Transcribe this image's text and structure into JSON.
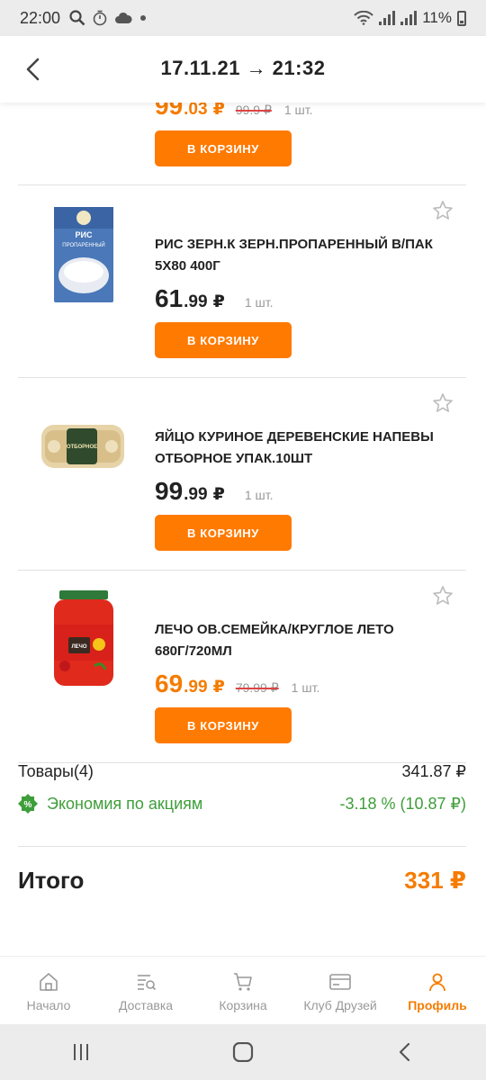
{
  "status_bar": {
    "time": "22:00",
    "battery": "11%"
  },
  "header": {
    "title": "17.11.21 → 21:32"
  },
  "items": [
    {
      "name": "",
      "price_rub": "99",
      "price_kop": ".03",
      "currency": "₽",
      "old_price": "99.9 ₽",
      "qty": "1 шт.",
      "button": "В КОРЗИНУ"
    },
    {
      "name": "РИС ЗЕРН.К ЗЕРН.ПРОПАРЕННЫЙ В/ПАК 5Х80 400Г",
      "price_rub": "61",
      "price_kop": ".99",
      "currency": "₽",
      "qty": "1 шт.",
      "button": "В КОРЗИНУ",
      "image_text": "РИС ПРОПАРЕННЫЙ"
    },
    {
      "name": "ЯЙЦО КУРИНОЕ ДЕРЕВЕНСКИЕ НАПЕВЫ ОТБОРНОЕ УПАК.10ШТ",
      "price_rub": "99",
      "price_kop": ".99",
      "currency": "₽",
      "qty": "1 шт.",
      "button": "В КОРЗИНУ",
      "image_text": "ОТБОРНОЕ"
    },
    {
      "name": "ЛЕЧО ОВ.СЕМЕЙКА/КРУГЛОЕ ЛЕТО 680Г/720МЛ",
      "price_rub": "69",
      "price_kop": ".99",
      "currency": "₽",
      "old_price": "79.99 ₽",
      "qty": "1 шт.",
      "button": "В КОРЗИНУ",
      "image_text": "ЛЕЧО"
    }
  ],
  "summary": {
    "goods_label": "Товары(4)",
    "goods_value": "341.87 ₽",
    "savings_label": "Экономия по акциям",
    "savings_value": "-3.18 % (10.87 ₽)",
    "total_label": "Итого",
    "total_value": "331 ₽"
  },
  "nav": [
    {
      "label": "Начало",
      "icon": "home-icon"
    },
    {
      "label": "Доставка",
      "icon": "delivery-list-icon"
    },
    {
      "label": "Корзина",
      "icon": "cart-icon"
    },
    {
      "label": "Клуб Друзей",
      "icon": "club-card-icon"
    },
    {
      "label": "Профиль",
      "icon": "profile-icon",
      "active": true
    }
  ],
  "colors": {
    "accent": "#ff7a00",
    "price_orange": "#f57c00",
    "savings_green": "#3e9e3a"
  }
}
